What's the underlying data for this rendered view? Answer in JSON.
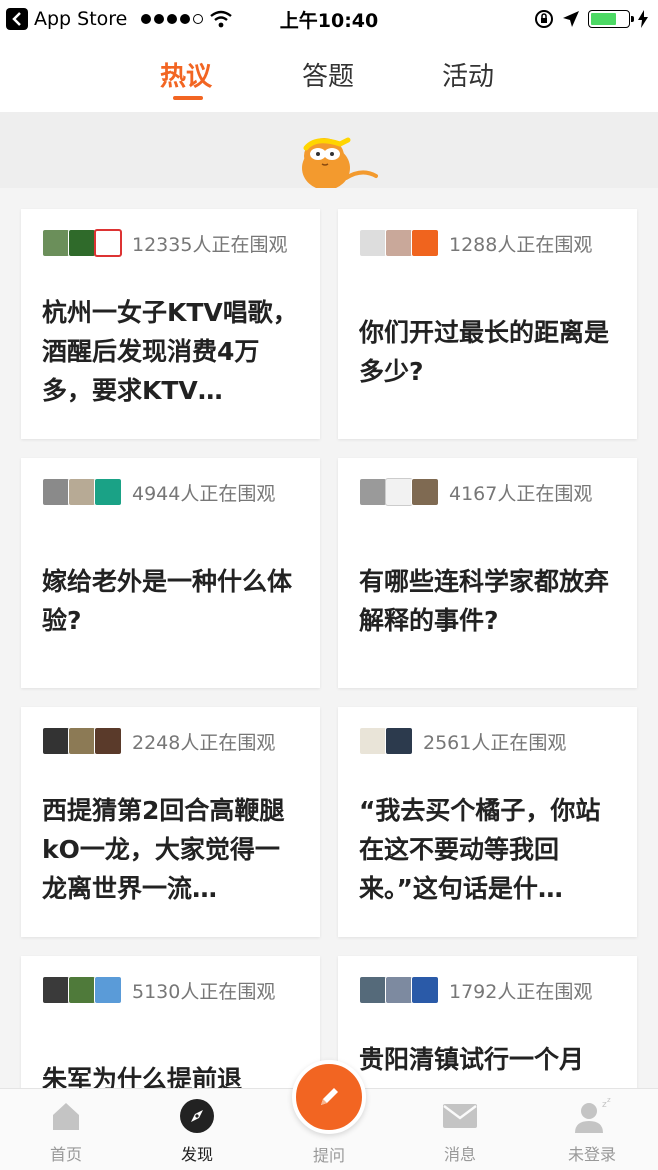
{
  "status_bar": {
    "back_app": "App Store",
    "time": "上午10:40",
    "battery_level": 0.7,
    "colors": {
      "battery": "#4cd964"
    }
  },
  "tabs": [
    {
      "label": "热议",
      "active": true
    },
    {
      "label": "答题",
      "active": false
    },
    {
      "label": "活动",
      "active": false
    }
  ],
  "accent_color": "#f26522",
  "cards": [
    {
      "watchers": "12335人正在围观",
      "title": "杭州一女子KTV唱歌，酒醒后发现消费4万多，要求KTV…"
    },
    {
      "watchers": "1288人正在围观",
      "title": "你们开过最长的距离是多少?"
    },
    {
      "watchers": "4944人正在围观",
      "title": "嫁给老外是一种什么体验?"
    },
    {
      "watchers": "4167人正在围观",
      "title": "有哪些连科学家都放弃解释的事件?"
    },
    {
      "watchers": "2248人正在围观",
      "title": "西提猜第2回合高鞭腿kO一龙，大家觉得一龙离世界一流…"
    },
    {
      "watchers": "2561人正在围观",
      "title": "“我去买个橘子，你站在这不要动等我回来。”这句话是什…"
    },
    {
      "watchers": "5130人正在围观",
      "title": "朱军为什么提前退"
    },
    {
      "watchers": "1792人正在围观",
      "title": "贵阳清镇试行一个月"
    }
  ],
  "bottom_nav": [
    {
      "label": "首页",
      "icon": "home-icon",
      "active": false
    },
    {
      "label": "发现",
      "icon": "compass-icon",
      "active": true
    },
    {
      "label": "提问",
      "icon": "pencil-icon",
      "active": false
    },
    {
      "label": "消息",
      "icon": "envelope-icon",
      "active": false
    },
    {
      "label": "未登录",
      "icon": "user-sleep-icon",
      "active": false
    }
  ]
}
